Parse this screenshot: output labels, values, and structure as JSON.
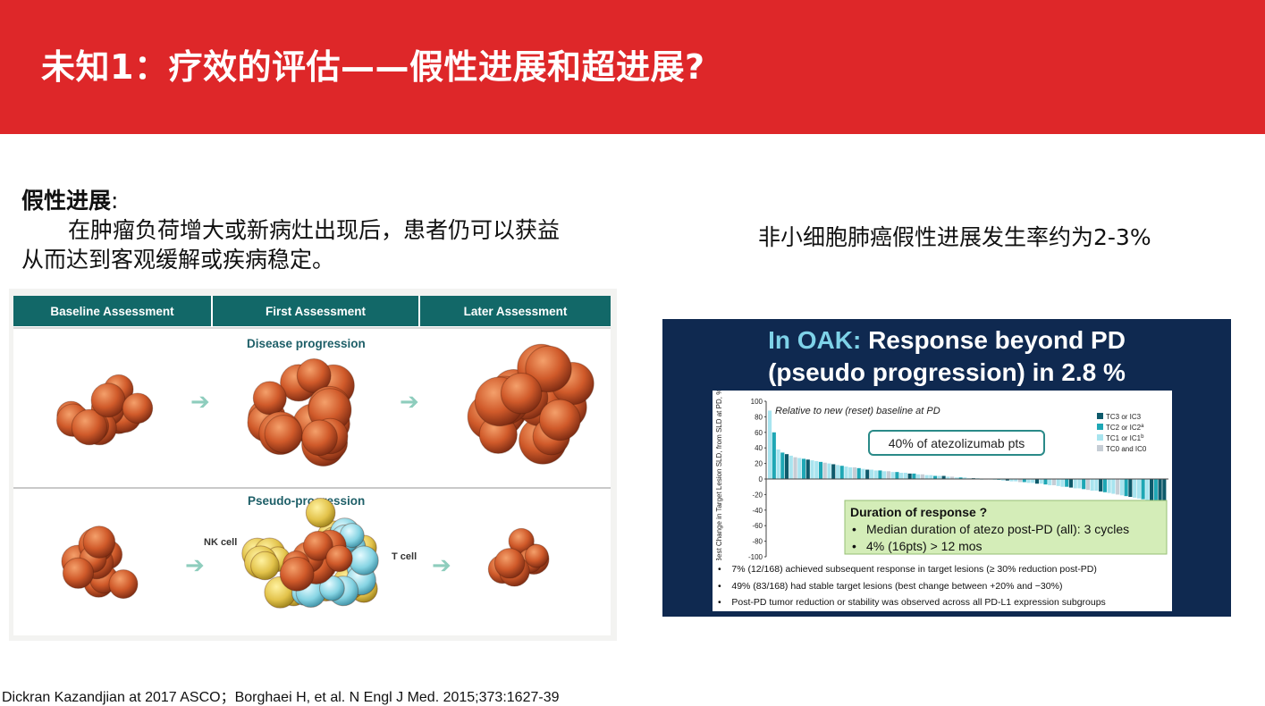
{
  "slide": {
    "title": "未知1：疗效的评估——假性进展和超进展?",
    "colors": {
      "banner": "#de2729",
      "teal": "#126868",
      "navy": "#0f2950",
      "green_box": "#d4edb8"
    }
  },
  "left_text": {
    "label": "假性进展",
    "colon": ":",
    "line1": "在肿瘤负荷增大或新病灶出现后，患者仍可以获益",
    "line2": "从而达到客观缓解或疾病稳定。"
  },
  "right_text": "非小细胞肺癌假性进展发生率约为2-3%",
  "left_figure": {
    "headers": [
      "Baseline Assessment",
      "First Assessment",
      "Later Assessment"
    ],
    "row1_title": "Disease progression",
    "row2_title": "Pseudo-progression",
    "nk_label": "NK cell",
    "t_label": "T cell"
  },
  "right_figure": {
    "title_highlight": "In OAK:",
    "title_rest": " Response beyond PD",
    "title_line2": "(pseudo progression) in 2.8 %",
    "chart_data": {
      "type": "bar",
      "annotation": "Relative to new (reset) baseline at PD",
      "ylabel": "Best Change in Target Lesion SLD, from SLD at PD, %",
      "ylim": [
        -100,
        100
      ],
      "yticks": [
        "100",
        "80",
        "60",
        "40",
        "20",
        "0",
        "-20",
        "-40",
        "-60",
        "-80",
        "-100"
      ],
      "callout": "40% of atezolizumab pts",
      "legend": [
        "TC3 or IC3",
        "TC2 or IC2",
        "TC1 or IC1",
        "TC0 and IC0"
      ],
      "legend_sup": [
        "",
        "a",
        "b",
        ""
      ],
      "legend_colors": [
        "#0e5a6b",
        "#1ea7b5",
        "#a8e4ef",
        "#c6cdd5"
      ],
      "legend_position": "top-right",
      "values": [
        88,
        60,
        38,
        34,
        32,
        30,
        28,
        27,
        26,
        25,
        24,
        23,
        22,
        21,
        20,
        19,
        18,
        17,
        16,
        15,
        15,
        14,
        13,
        12,
        12,
        11,
        11,
        10,
        10,
        9,
        9,
        8,
        8,
        7,
        7,
        6,
        6,
        5,
        5,
        4,
        4,
        4,
        3,
        3,
        2,
        2,
        2,
        1,
        1,
        1,
        0,
        0,
        0,
        -1,
        -1,
        -2,
        -2,
        -3,
        -3,
        -4,
        -4,
        -5,
        -5,
        -6,
        -6,
        -7,
        -8,
        -8,
        -9,
        -10,
        -10,
        -11,
        -12,
        -12,
        -13,
        -14,
        -15,
        -15,
        -16,
        -17,
        -18,
        -19,
        -20,
        -21,
        -22,
        -23,
        -24,
        -25,
        -26,
        -28,
        -29,
        -30,
        -31,
        -32
      ],
      "tiers": [
        2,
        1,
        2,
        1,
        0,
        2,
        3,
        2,
        1,
        0,
        2,
        2,
        1,
        3,
        2,
        0,
        2,
        1,
        2,
        2,
        3,
        1,
        2,
        0,
        2,
        2,
        1,
        2,
        3,
        2,
        1,
        2,
        2,
        0,
        1,
        2,
        3,
        2,
        2,
        1,
        2,
        0,
        2,
        3,
        2,
        1,
        2,
        2,
        0,
        2,
        1,
        3,
        2,
        2,
        1,
        2,
        0,
        2,
        2,
        3,
        1,
        2,
        2,
        0,
        2,
        1,
        2,
        3,
        2,
        2,
        1,
        0,
        2,
        2,
        1,
        3,
        2,
        2,
        0,
        1,
        2,
        2,
        3,
        2,
        1,
        0,
        2,
        2,
        1,
        2,
        0,
        1,
        0,
        0
      ]
    },
    "duration_box": {
      "title": "Duration of response ?",
      "bullet1": "Median duration of atezo post-PD (all): 3 cycles",
      "bullet2": "4% (16pts) > 12 mos"
    },
    "notes": [
      "7% (12/168) achieved subsequent response in target lesions (≥ 30% reduction post-PD)",
      "49% (83/168) had stable target lesions (best change between +20% and −30%)",
      "Post-PD tumor reduction or stability was observed across all PD-L1 expression subgroups"
    ]
  },
  "citation": "Dickran Kazandjian at 2017 ASCO；Borghaei H, et al. N Engl J Med. 2015;373:1627-39"
}
